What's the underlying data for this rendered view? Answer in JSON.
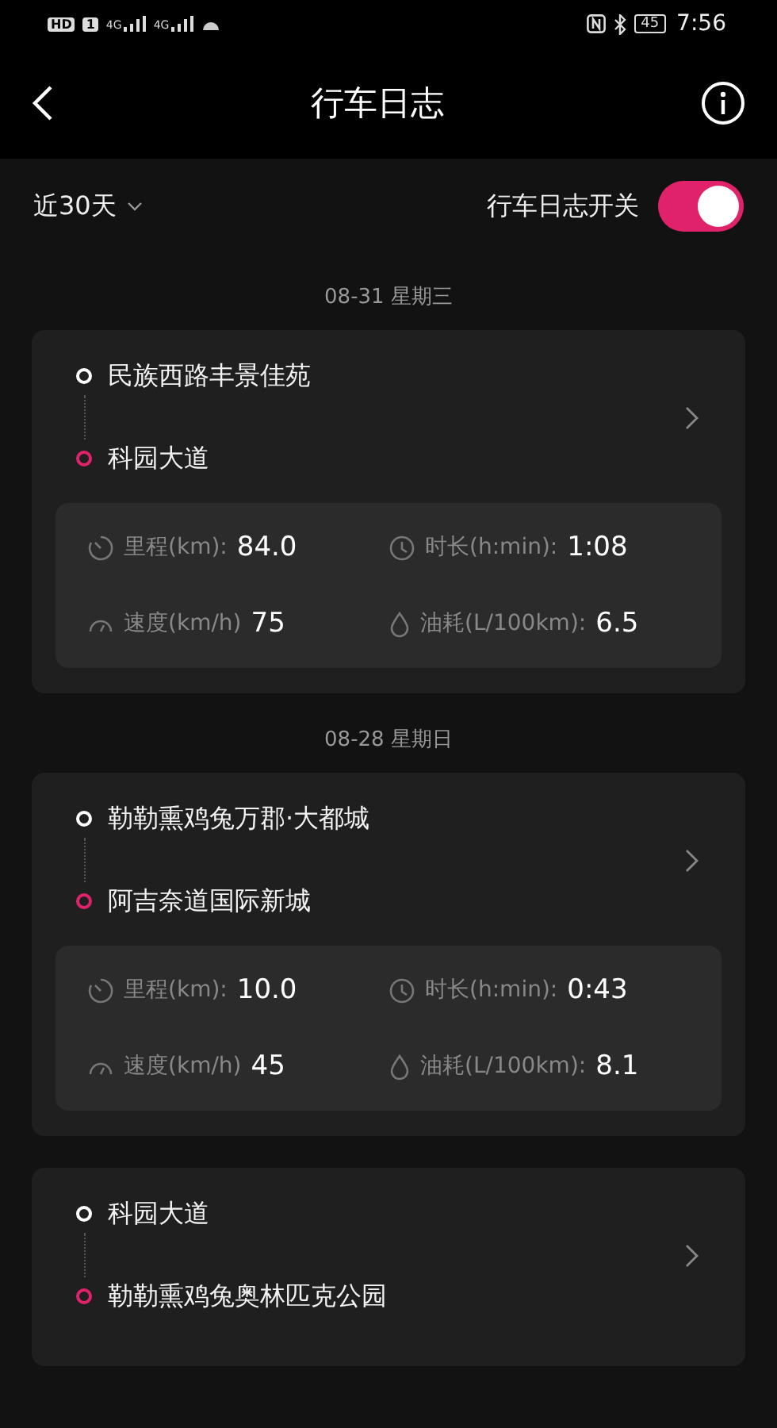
{
  "status_bar": {
    "badges": [
      "HD",
      "1"
    ],
    "networks": [
      "4G",
      "4G"
    ],
    "battery": "45",
    "time": "7:56"
  },
  "header": {
    "title": "行车日志"
  },
  "filter": {
    "range": "近30天",
    "switch_label": "行车日志开关",
    "switch_on": true
  },
  "days": [
    {
      "date": "08-31 星期三",
      "trips": [
        {
          "from": "民族西路丰景佳苑",
          "to": "科园大道",
          "stats": [
            {
              "kind": "distance",
              "label": "里程(km):",
              "value": "84.0"
            },
            {
              "kind": "duration",
              "label": "时长(h:min):",
              "value": "1:08"
            },
            {
              "kind": "speed",
              "label": "速度(km/h)",
              "value": "75"
            },
            {
              "kind": "fuel",
              "label": "油耗(L/100km):",
              "value": "6.5"
            }
          ]
        }
      ]
    },
    {
      "date": "08-28 星期日",
      "trips": [
        {
          "from": "勒勒熏鸡兔万郡·大都城",
          "to": "阿吉奈道国际新城",
          "stats": [
            {
              "kind": "distance",
              "label": "里程(km):",
              "value": "10.0"
            },
            {
              "kind": "duration",
              "label": "时长(h:min):",
              "value": "0:43"
            },
            {
              "kind": "speed",
              "label": "速度(km/h)",
              "value": "45"
            },
            {
              "kind": "fuel",
              "label": "油耗(L/100km):",
              "value": "8.1"
            }
          ]
        },
        {
          "from": "科园大道",
          "to": "勒勒熏鸡兔奥林匹克公园"
        }
      ]
    }
  ]
}
